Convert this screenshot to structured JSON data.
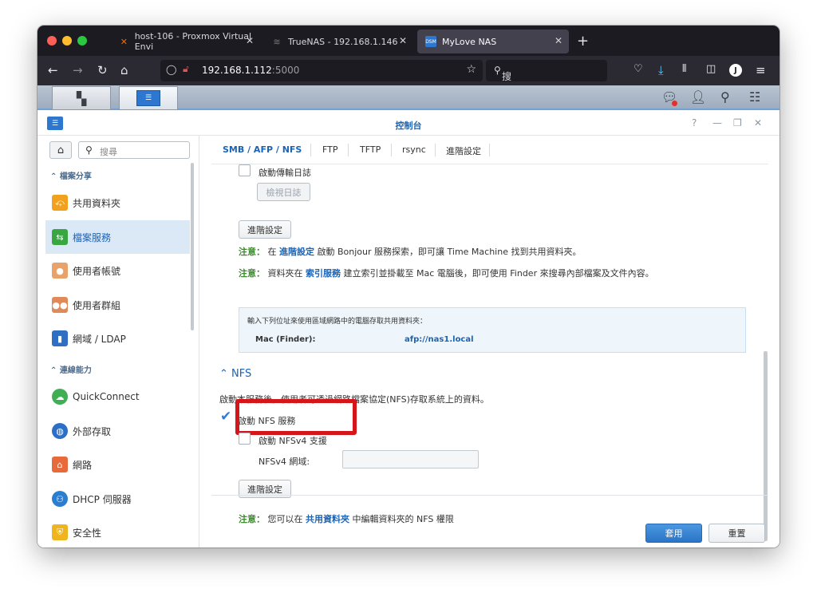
{
  "browser": {
    "tabs": [
      {
        "title": "host-106 - Proxmox Virtual Envi",
        "icon": "proxmox-icon"
      },
      {
        "title": "TrueNAS - 192.168.1.146",
        "icon": "truenas-icon"
      },
      {
        "title": "MyLove NAS",
        "icon": "dsm-icon",
        "icon_text": "DSM"
      }
    ],
    "url_host": "192.168.1.112",
    "url_port": ":5000",
    "search_placeholder": "搜尋",
    "profile_letter": "J"
  },
  "control_panel": {
    "title": "控制台",
    "help": "?"
  },
  "sidebar": {
    "search_placeholder": "搜尋",
    "sections": [
      {
        "label": "檔案分享"
      },
      {
        "label": "連線能力"
      }
    ],
    "items": [
      {
        "label": "共用資料夾",
        "icon": "shared-folder-icon"
      },
      {
        "label": "檔案服務",
        "icon": "file-services-icon"
      },
      {
        "label": "使用者帳號",
        "icon": "user-icon"
      },
      {
        "label": "使用者群組",
        "icon": "group-icon"
      },
      {
        "label": "網域 / LDAP",
        "icon": "domain-ldap-icon"
      },
      {
        "label": "QuickConnect",
        "icon": "quickconnect-icon"
      },
      {
        "label": "外部存取",
        "icon": "external-access-icon"
      },
      {
        "label": "網路",
        "icon": "network-icon"
      },
      {
        "label": "DHCP 伺服器",
        "icon": "dhcp-server-icon"
      },
      {
        "label": "安全性",
        "icon": "security-icon"
      }
    ]
  },
  "main": {
    "tabs": [
      "SMB / AFP / NFS",
      "FTP",
      "TFTP",
      "rsync",
      "進階設定"
    ],
    "afp": {
      "enable_transfer_log": "啟動傳輸日誌",
      "view_log_button": "檢視日誌",
      "advanced_button": "進階設定",
      "note1": {
        "prefix": "注意：",
        "pre": "在",
        "link": "進階設定",
        "post": "啟動 Bonjour 服務探索，即可讓 Time Machine 找到共用資料夾。"
      },
      "note2": {
        "prefix": "注意：",
        "pre": "資料夾在",
        "link": "索引服務",
        "post": "建立索引並掛載至 Mac 電腦後，即可使用 Finder 來搜尋內部檔案及文件內容。"
      },
      "info_text": "輸入下列位址來使用區域網路中的電腦存取共用資料夾：",
      "mac_label": "Mac (Finder):",
      "mac_address": "afp://nas1.local"
    },
    "nfs": {
      "header": "NFS",
      "description": "啟動本服務後，使用者可透過網路檔案協定(NFS)存取系統上的資料。",
      "enable_nfs": "啟動 NFS 服務",
      "enable_nfs_checked": true,
      "enable_nfsv4": "啟動 NFSv4 支援",
      "enable_nfsv4_checked": false,
      "nfsv4_domain_label": "NFSv4 網域:",
      "nfsv4_domain_value": "",
      "advanced_button": "進階設定",
      "note": {
        "prefix": "注意：",
        "pre": "您可以在",
        "link": "共用資料夾",
        "post": "中編輯資料夾的 NFS 權限"
      }
    },
    "footer": {
      "apply": "套用",
      "reset": "重置"
    }
  },
  "colors": {
    "accent": "#1b63b5",
    "note_green": "#3d8a2e",
    "highlight_red": "#d4161b",
    "apply_blue": "#2a75c6"
  }
}
